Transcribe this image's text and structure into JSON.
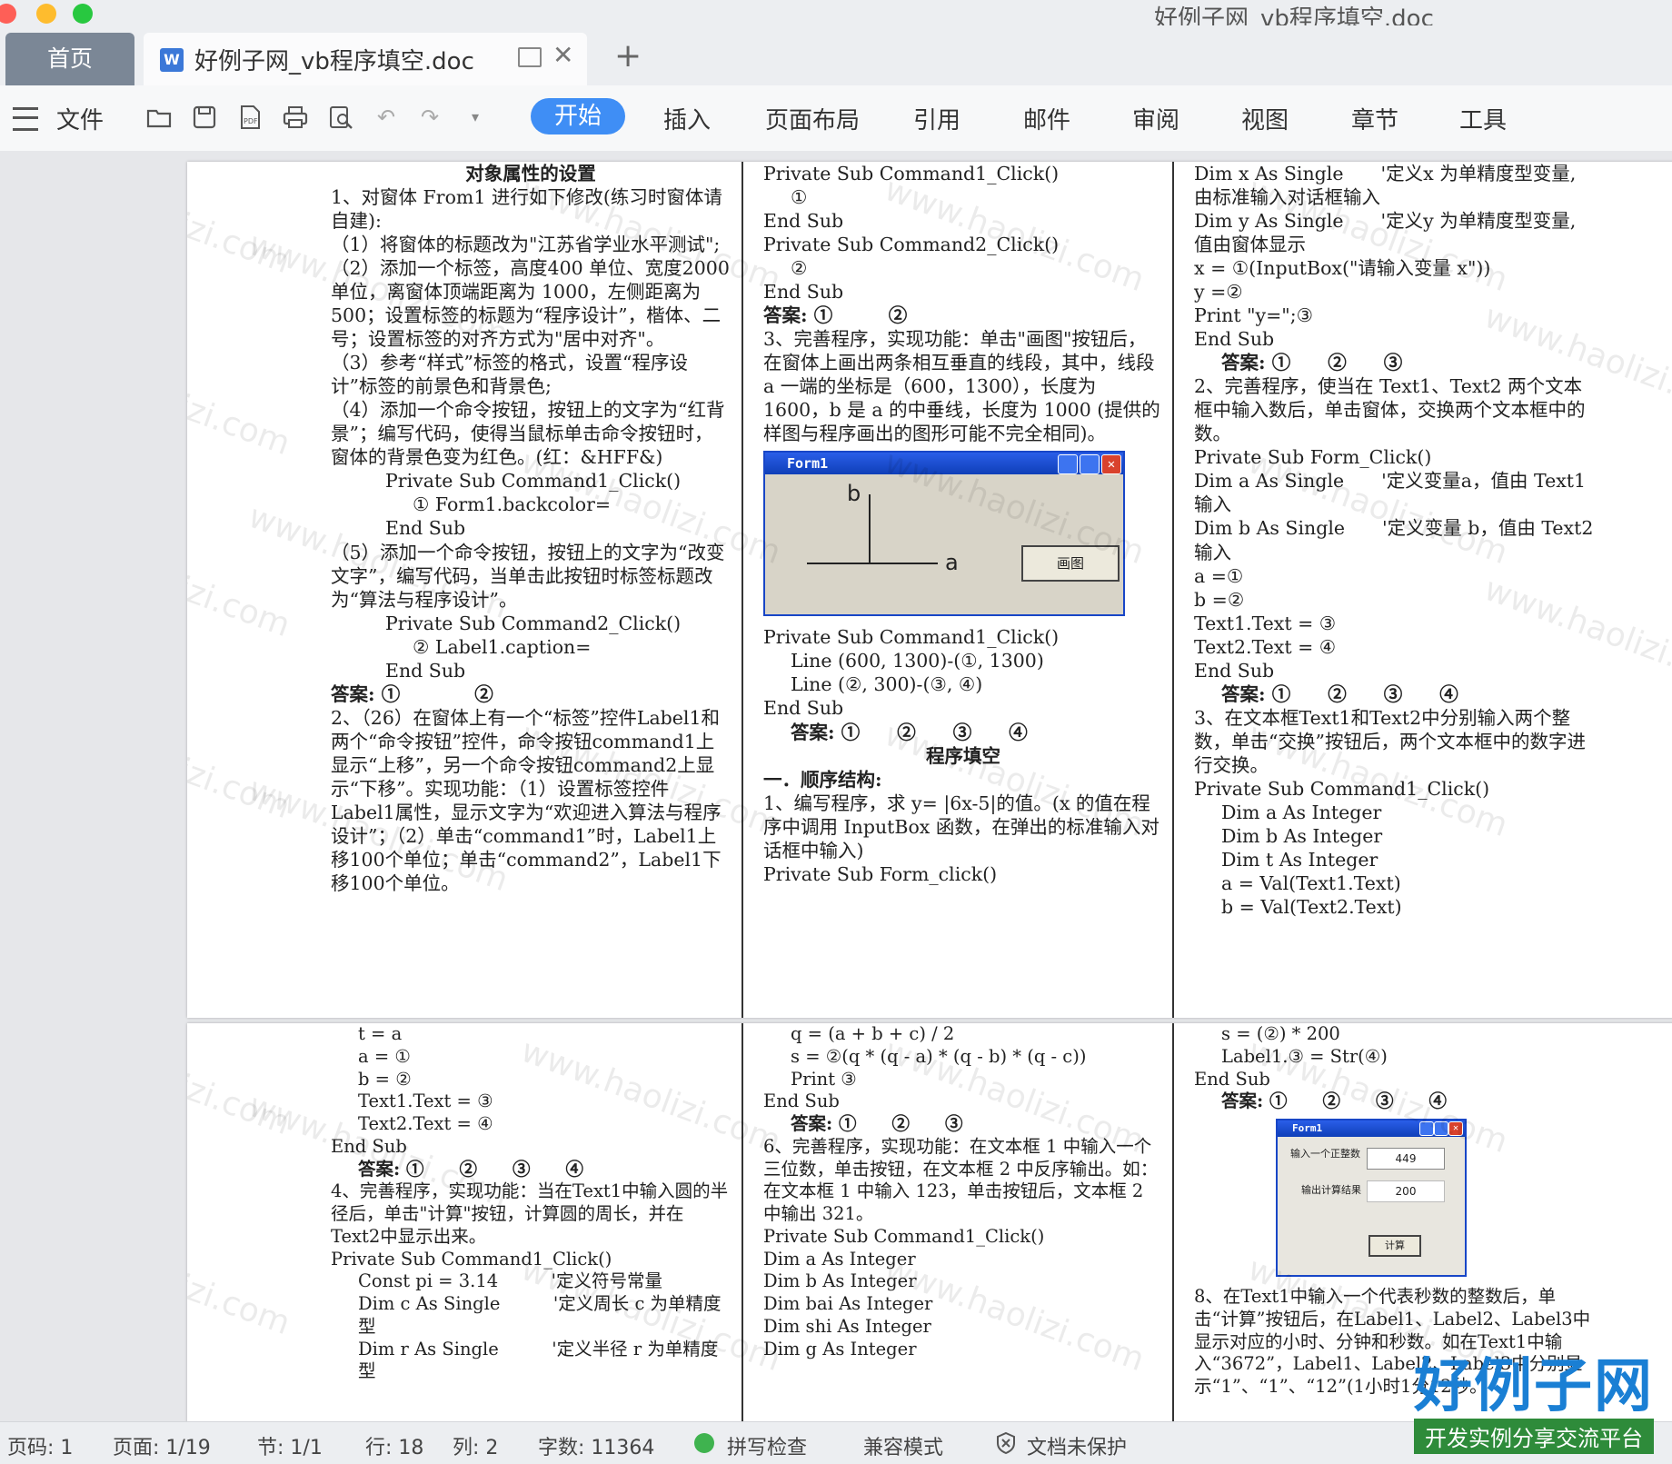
{
  "window": {
    "title": "好例子网_vb程序填空.doc"
  },
  "tabs": {
    "home": "首页",
    "doc": "好例子网_vb程序填空.doc"
  },
  "toolbar": {
    "file_menu": "文件",
    "ribbon": [
      "开始",
      "插入",
      "页面布局",
      "引用",
      "邮件",
      "审阅",
      "视图",
      "章节",
      "工具"
    ],
    "icons": [
      "open-folder-icon",
      "save-icon",
      "pdf-icon",
      "print-icon",
      "print-preview-icon",
      "undo-icon",
      "redo-icon",
      "more-icon"
    ]
  },
  "watermark": "www.haolizi.com",
  "page1": {
    "col1": [
      {
        "t": "对象属性的设置",
        "cls": "heading"
      },
      {
        "t": "1、对窗体 From1 进行如下修改(练习时窗体请自建):"
      },
      {
        "t": "（1）将窗体的标题改为\"江苏省学业水平测试\";"
      },
      {
        "t": "（2）添加一个标签，高度400 单位、宽度2000 单位，离窗体顶端距离为 1000，左侧距离为 500；设置标签的标题为“程序设计”，楷体、二号；设置标签的对齐方式为\"居中对齐\"。"
      },
      {
        "t": "（3）参考“样式”标签的格式，设置“程序设计”标签的前景色和背景色;"
      },
      {
        "t": "（4）添加一个命令按钮，按钮上的文字为“红背景”；编写代码，使得当鼠标单击命令按钮时，窗体的背景色变为红色。(红：&HFF&)"
      },
      {
        "t": "Private Sub Command1_Click()",
        "cls": "indent2"
      },
      {
        "t": "① Form1.backcolor=",
        "cls": "indent3"
      },
      {
        "t": "End Sub",
        "cls": "indent2"
      },
      {
        "t": "（5）添加一个命令按钮，按钮上的文字为“改变文字”，编写代码，当单击此按钮时标签标题改为“算法与程序设计”。"
      },
      {
        "t": "Private Sub Command2_Click()",
        "cls": "indent2"
      },
      {
        "t": "② Label1.caption=",
        "cls": "indent3"
      },
      {
        "t": "End Sub",
        "cls": "indent2"
      },
      {
        "t": "答案: ①　　　　②",
        "cls": "bold"
      },
      {
        "t": " "
      },
      {
        "t": "2、（26）在窗体上有一个“标签”控件Label1和两个“命令按钮”控件，命令按钮command1上显示“上移”，另一个命令按钮command2上显示“下移”。实现功能：（1）设置标签控件Label1属性，显示文字为“欢迎进入算法与程序设计”；（2）单击“command1”时，Label1上移100个单位；单击“command2”，Label1下移100个单位。"
      }
    ],
    "col2a": [
      {
        "t": "Private Sub Command1_Click()"
      },
      {
        "t": "①",
        "cls": "indent1"
      },
      {
        "t": "End Sub"
      },
      {
        "t": "Private Sub Command2_Click()"
      },
      {
        "t": "②",
        "cls": "indent1"
      },
      {
        "t": "End Sub"
      },
      {
        "t": "答案: ①　　　②",
        "cls": "bold"
      },
      {
        "t": " "
      },
      {
        "t": "3、完善程序，实现功能：单击\"画图\"按钮后，在窗体上画出两条相互垂直的线段，其中，线段 a 一端的坐标是（600，1300），长度为 1600，b 是 a 的中垂线，长度为 1000 (提供的样图与程序画出的图形可能不完全相同)。"
      }
    ],
    "form1": {
      "title": "Form1",
      "label_b": "b",
      "label_a": "a",
      "button": "画图"
    },
    "col2b": [
      {
        "t": "Private Sub Command1_Click()"
      },
      {
        "t": "Line (600, 1300)-(①, 1300)",
        "cls": "indent1"
      },
      {
        "t": "Line (②, 300)-(③, ④)",
        "cls": "indent1"
      },
      {
        "t": "End Sub"
      },
      {
        "t": "答案: ①　　②　　③　　④",
        "cls": "bold indent1"
      },
      {
        "t": " "
      },
      {
        "t": "程序填空",
        "cls": "heading"
      },
      {
        "t": "一．顺序结构:",
        "cls": "bold"
      },
      {
        "t": "1、编写程序，求 y= |6x-5|的值。(x 的值在程序中调用 InputBox 函数，在弹出的标准输入对话框中输入)"
      },
      {
        "t": "Private Sub Form_click()"
      }
    ],
    "col3": [
      {
        "t": "Dim x As Single　　'定义x 为单精度型变量,由标准输入对话框输入"
      },
      {
        "t": "Dim y As Single　　'定义y 为单精度型变量,值由窗体显示"
      },
      {
        "t": "x = ①(InputBox(\"请输入变量 x\"))"
      },
      {
        "t": "y =②"
      },
      {
        "t": "Print \"y=\";③"
      },
      {
        "t": "End Sub"
      },
      {
        "t": "答案: ①　　②　　③",
        "cls": "bold indent1"
      },
      {
        "t": " "
      },
      {
        "t": "2、完善程序，使当在 Text1、Text2 两个文本框中输入数后，单击窗体，交换两个文本框中的数。"
      },
      {
        "t": "Private Sub Form_Click()"
      },
      {
        "t": "Dim a As Single　　'定义变量a，值由 Text1 输入"
      },
      {
        "t": "Dim b As Single　　'定义变量 b，值由 Text2 输入"
      },
      {
        "t": "a =①"
      },
      {
        "t": "b =②"
      },
      {
        "t": "Text1.Text = ③"
      },
      {
        "t": "Text2.Text = ④"
      },
      {
        "t": "End Sub"
      },
      {
        "t": "答案: ①　　②　　③　　④",
        "cls": "bold indent1"
      },
      {
        "t": " "
      },
      {
        "t": "3、在文本框Text1和Text2中分别输入两个整数，单击“交换”按钮后，两个文本框中的数字进行交换。"
      },
      {
        "t": "Private Sub Command1_Click()"
      },
      {
        "t": "Dim a As Integer",
        "cls": "indent1"
      },
      {
        "t": "Dim b As Integer",
        "cls": "indent1"
      },
      {
        "t": "Dim t As Integer",
        "cls": "indent1"
      },
      {
        "t": "a = Val(Text1.Text)",
        "cls": "indent1"
      },
      {
        "t": "b = Val(Text2.Text)",
        "cls": "indent1"
      }
    ]
  },
  "page2": {
    "col1": [
      {
        "t": "t = a",
        "cls": "indent1"
      },
      {
        "t": "a = ①",
        "cls": "indent1"
      },
      {
        "t": "b = ②",
        "cls": "indent1"
      },
      {
        "t": "Text1.Text = ③",
        "cls": "indent1"
      },
      {
        "t": "Text2.Text = ④",
        "cls": "indent1"
      },
      {
        "t": "End Sub"
      },
      {
        "t": "答案: ①　　②　　③　　④",
        "cls": "bold indent1"
      },
      {
        "t": " "
      },
      {
        "t": "4、完善程序，实现功能：当在Text1中输入圆的半径后，单击\"计算\"按钮，计算圆的周长，并在Text2中显示出来。"
      },
      {
        "t": "Private Sub Command1_Click()"
      },
      {
        "t": "Const pi = 3.14　　　'定义符号常量",
        "cls": "indent1"
      },
      {
        "t": "Dim c As Single　　　'定义周长 c 为单精度型",
        "cls": "indent1"
      },
      {
        "t": "Dim r As Single　　　'定义半径 r 为单精度型",
        "cls": "indent1"
      }
    ],
    "col2": [
      {
        "t": "q = (a + b + c) / 2",
        "cls": "indent1"
      },
      {
        "t": "s = ②(q * (q - a) * (q - b) * (q - c))",
        "cls": "indent1"
      },
      {
        "t": "Print ③",
        "cls": "indent1"
      },
      {
        "t": "End Sub"
      },
      {
        "t": "答案: ①　　②　　③",
        "cls": "bold indent1"
      },
      {
        "t": " "
      },
      {
        "t": "6、完善程序，实现功能：在文本框 1 中输入一个三位数，单击按钮，在文本框 2 中反序输出。如：在文本框 1 中输入 123，单击按钮后，文本框 2 中输出 321。"
      },
      {
        "t": "Private Sub Command1_Click()"
      },
      {
        "t": "Dim a As Integer"
      },
      {
        "t": "Dim b As Integer"
      },
      {
        "t": "Dim bai As Integer"
      },
      {
        "t": "Dim shi As Integer"
      },
      {
        "t": "Dim g As Integer"
      }
    ],
    "col3a": [
      {
        "t": "s = (②) * 200",
        "cls": "indent1"
      },
      {
        "t": "Label1.③ = Str(④)",
        "cls": "indent1"
      },
      {
        "t": "End Sub"
      },
      {
        "t": "答案: ①　　②　　③　　④",
        "cls": "bold indent1"
      }
    ],
    "form2": {
      "title": "Form1",
      "label1": "输入一个正整数",
      "value1": "449",
      "label2": "输出计算结果",
      "value2": "200",
      "button": "计算"
    },
    "col3b": [
      {
        "t": "8、在Text1中输入一个代表秒数的整数后，单击“计算”按钮后，在Label1、Label2、Label3中显示对应的小时、分钟和秒数。如在Text1中输入“3672”，Label1、Label2、Label3中分别显示“1”、“1”、“12”(1小时1分12秒。"
      }
    ]
  },
  "status": {
    "page_no": "页码: 1",
    "pages": "页面: 1/19",
    "section": "节: 1/1",
    "row": "行: 18",
    "col": "列: 2",
    "word_count": "字数: 11364",
    "spell_check": "拼写检查",
    "compat": "兼容模式",
    "protect": "文档未保护"
  },
  "logo": {
    "title": "好例子网",
    "subtitle": "开发实例分享交流平台"
  },
  "colors": {
    "accent": "#3f8ef5",
    "tab_home": "#7b8796",
    "logo_blue": "#1a7fd4",
    "logo_bar": "#2e8b3a"
  }
}
